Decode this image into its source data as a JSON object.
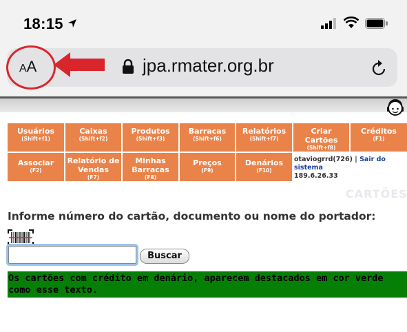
{
  "status": {
    "time": "18:15"
  },
  "browser": {
    "text_size_label": "AA",
    "url": "jpa.rmater.org.br"
  },
  "menu": {
    "row1": [
      {
        "label": "Usuários",
        "shortcut": "(Shift+f1)"
      },
      {
        "label": "Caixas",
        "shortcut": "(Shift+f2)"
      },
      {
        "label": "Produtos",
        "shortcut": "(Shift+f3)"
      },
      {
        "label": "Barracas",
        "shortcut": "(Shift+f6)"
      },
      {
        "label": "Relatórios",
        "shortcut": "(Shift+f7)"
      },
      {
        "label": "Criar Cartões",
        "shortcut": "(Shift+f8)"
      },
      {
        "label": "Créditos",
        "shortcut": "(F1)"
      }
    ],
    "row2": [
      {
        "label": "Associar",
        "shortcut": "(F2)"
      },
      {
        "label": "Relatório de Vendas",
        "shortcut": "(F7)"
      },
      {
        "label": "Minhas Barracas",
        "shortcut": "(F8)"
      },
      {
        "label": "Preços",
        "shortcut": "(F9)"
      },
      {
        "label": "Denários",
        "shortcut": "(F10)"
      }
    ]
  },
  "session": {
    "user": "otaviogrrd(726)",
    "separator": "|",
    "logout": "Sair do sistema",
    "ip": "189.6.26.33"
  },
  "page": {
    "section_title": "CARTÕES",
    "prompt": "Informe número do cartão, documento ou nome do portador:",
    "search_value": "",
    "search_button": "Buscar",
    "note": "Os cartões com crédito em denário, aparecem destacados em cor verde como esse texto."
  },
  "colors": {
    "menu_bg": "#e9834a",
    "highlight_green": "#067f06",
    "annotation_red": "#d8262c"
  }
}
